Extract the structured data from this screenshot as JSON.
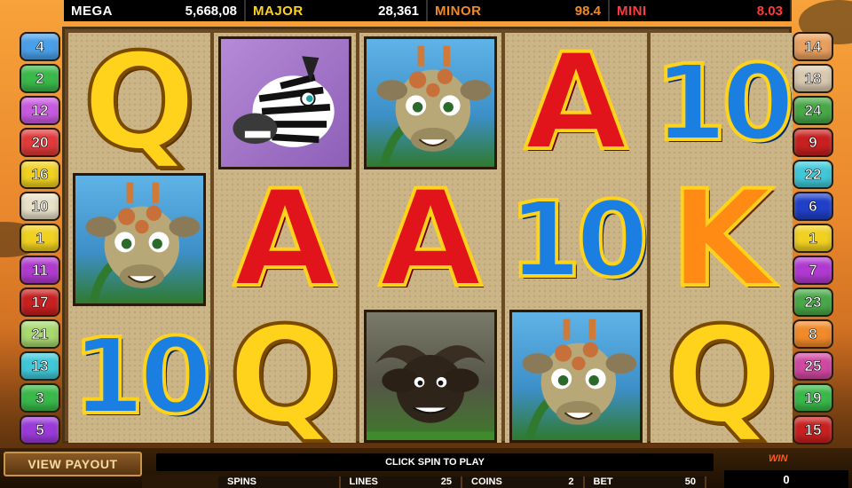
{
  "jackpots": [
    {
      "name": "MEGA",
      "value": "5,668,08",
      "color": "#ffffff"
    },
    {
      "name": "MAJOR",
      "value": "28,361",
      "color": "#ffd21c"
    },
    {
      "name": "MINOR",
      "value": "98.4",
      "color": "#f08a2a"
    },
    {
      "name": "MINI",
      "value": "8.03",
      "color": "#ff3b3b"
    }
  ],
  "reels": [
    [
      "Q",
      "giraffe",
      "10"
    ],
    [
      "zebra",
      "A",
      "Q"
    ],
    [
      "giraffe",
      "A",
      "buffalo"
    ],
    [
      "A",
      "10",
      "giraffe"
    ],
    [
      "10",
      "K",
      "Q"
    ]
  ],
  "paylines_left": [
    {
      "num": "4",
      "color": "#4aa0e8"
    },
    {
      "num": "2",
      "color": "#3ab84a"
    },
    {
      "num": "12",
      "color": "#c85ae0"
    },
    {
      "num": "20",
      "color": "#e03a3a"
    },
    {
      "num": "16",
      "color": "#f0d020"
    },
    {
      "num": "10",
      "color": "#e8e0c8"
    },
    {
      "num": "1",
      "color": "#f0d020"
    },
    {
      "num": "11",
      "color": "#b03ad0"
    },
    {
      "num": "17",
      "color": "#c82020"
    },
    {
      "num": "21",
      "color": "#a8d870"
    },
    {
      "num": "13",
      "color": "#40c8d8"
    },
    {
      "num": "3",
      "color": "#3ab84a"
    },
    {
      "num": "5",
      "color": "#9a3ad8"
    }
  ],
  "paylines_right": [
    {
      "num": "14",
      "color": "#e8a060"
    },
    {
      "num": "18",
      "color": "#d8c8b0"
    },
    {
      "num": "24",
      "color": "#48a848"
    },
    {
      "num": "9",
      "color": "#c82020"
    },
    {
      "num": "22",
      "color": "#40c8d8"
    },
    {
      "num": "6",
      "color": "#2040c8"
    },
    {
      "num": "1",
      "color": "#f0d020"
    },
    {
      "num": "7",
      "color": "#b03ad0"
    },
    {
      "num": "23",
      "color": "#48a848"
    },
    {
      "num": "8",
      "color": "#f08a2a"
    },
    {
      "num": "25",
      "color": "#d048a0"
    },
    {
      "num": "19",
      "color": "#3ab84a"
    },
    {
      "num": "15",
      "color": "#c82020"
    }
  ],
  "buttons": {
    "view_payout": "VIEW PAYOUT"
  },
  "message": "CLICK SPIN TO PLAY",
  "win": {
    "label": "WIN",
    "value": "0"
  },
  "controls": [
    {
      "label": "SPINS",
      "value": ""
    },
    {
      "label": "LINES",
      "value": "25"
    },
    {
      "label": "COINS",
      "value": "2"
    },
    {
      "label": "BET",
      "value": "50"
    }
  ]
}
